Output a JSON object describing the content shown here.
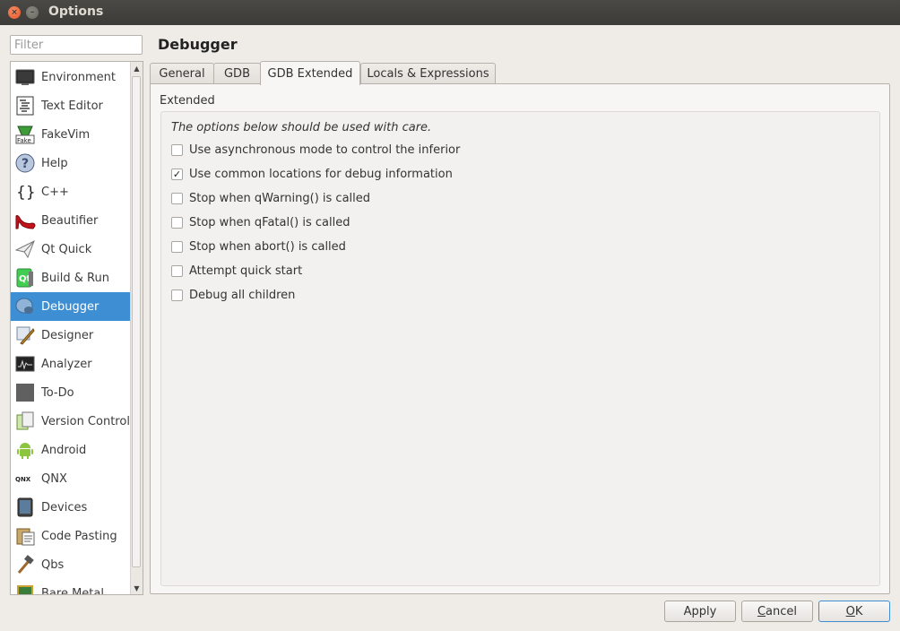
{
  "window": {
    "title": "Options",
    "close_glyph": "×",
    "minimize_glyph": "–"
  },
  "filter": {
    "placeholder": "Filter",
    "value": ""
  },
  "categories": [
    {
      "label": "Environment",
      "icon": "monitor-icon"
    },
    {
      "label": "Text Editor",
      "icon": "text-document-icon"
    },
    {
      "label": "FakeVim",
      "icon": "fakevim-icon"
    },
    {
      "label": "Help",
      "icon": "question-icon"
    },
    {
      "label": "C++",
      "icon": "braces-icon"
    },
    {
      "label": "Beautifier",
      "icon": "high-heel-icon"
    },
    {
      "label": "Qt Quick",
      "icon": "paper-plane-icon"
    },
    {
      "label": "Build & Run",
      "icon": "qt-build-icon"
    },
    {
      "label": "Debugger",
      "icon": "bug-icon",
      "selected": true
    },
    {
      "label": "Designer",
      "icon": "designer-icon"
    },
    {
      "label": "Analyzer",
      "icon": "oscilloscope-icon"
    },
    {
      "label": "To-Do",
      "icon": "todo-icon"
    },
    {
      "label": "Version Control",
      "icon": "version-control-icon"
    },
    {
      "label": "Android",
      "icon": "android-icon"
    },
    {
      "label": "QNX",
      "icon": "qnx-icon"
    },
    {
      "label": "Devices",
      "icon": "device-icon"
    },
    {
      "label": "Code Pasting",
      "icon": "clipboard-icon"
    },
    {
      "label": "Qbs",
      "icon": "hammer-icon"
    },
    {
      "label": "Bare Metal",
      "icon": "chip-icon"
    }
  ],
  "page": {
    "title": "Debugger"
  },
  "tabs": [
    {
      "label": "General"
    },
    {
      "label": "GDB"
    },
    {
      "label": "GDB Extended",
      "active": true
    },
    {
      "label": "Locals & Expressions"
    }
  ],
  "extended": {
    "group_title": "Extended",
    "note": "The options below should be used with care.",
    "options": [
      {
        "label": "Use asynchronous mode to control the inferior",
        "checked": false
      },
      {
        "label": "Use common locations for debug information",
        "checked": true
      },
      {
        "label": "Stop when qWarning() is called",
        "checked": false
      },
      {
        "label": "Stop when qFatal() is called",
        "checked": false
      },
      {
        "label": "Stop when abort() is called",
        "checked": false
      },
      {
        "label": "Attempt quick start",
        "checked": false
      },
      {
        "label": "Debug all children",
        "checked": false
      }
    ]
  },
  "buttons": {
    "apply": "Apply",
    "cancel_mnemonic": "C",
    "cancel_rest": "ancel",
    "ok_mnemonic": "O",
    "ok_rest": "K"
  },
  "checkmark": "✓",
  "scroll_up_glyph": "▲",
  "scroll_down_glyph": "▼",
  "colors": {
    "selection": "#3d8ed3",
    "titlebar": "#3c3b37",
    "close": "#e2582a"
  }
}
